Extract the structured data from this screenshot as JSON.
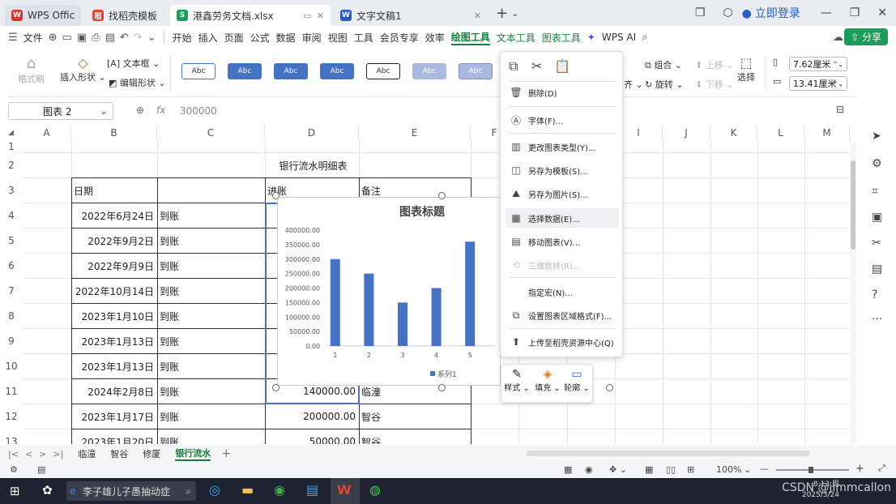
{
  "tabs": [
    {
      "label": "WPS Office",
      "icon_color": "#d6372c"
    },
    {
      "label": "找稻壳模板",
      "icon_color": "#e0422e"
    },
    {
      "label": "港鑫劳务文档.xlsx",
      "icon_color": "#1a9d56"
    },
    {
      "label": "文字文稿1",
      "icon_color": "#2b5cc5"
    }
  ],
  "login_label": "立即登录",
  "menu": {
    "file": "文件",
    "items": [
      "开始",
      "插入",
      "页面",
      "公式",
      "数据",
      "审阅",
      "视图",
      "工具",
      "会员专享",
      "效率"
    ],
    "draw_tool": "绘图工具",
    "text_tool": "文本工具",
    "chart_tool": "图表工具",
    "ai": "WPS AI",
    "share": "分享"
  },
  "ribbon": {
    "format_painter": "格式刷",
    "insert_shape": "插入形状",
    "textbox": "文本框",
    "edit_shape": "编辑形状",
    "style_label": "Abc",
    "group": "组合",
    "rotate": "旋转",
    "move_up": "上移",
    "move_down": "下移",
    "align_short": "齐",
    "select": "选择",
    "width": "7.62厘米",
    "height": "13.41厘米"
  },
  "formula_bar": {
    "name": "图表 2",
    "fx": "fx",
    "value": "300000"
  },
  "columns": [
    "A",
    "B",
    "C",
    "D",
    "E",
    "F",
    "G",
    "H",
    "I",
    "J",
    "K",
    "L",
    "M"
  ],
  "rows": [
    "1",
    "2",
    "3",
    "4",
    "5",
    "6",
    "7",
    "8",
    "9",
    "10",
    "11",
    "12",
    "13"
  ],
  "table": {
    "title": "银行流水明细表",
    "headers": [
      "日期",
      "进账",
      "备注"
    ],
    "dates": [
      "2022年6月24日",
      "2022年9月2日",
      "2022年9月9日",
      "2022年10月14日",
      "2023年1月10日",
      "2023年1月13日",
      "2023年1月13日",
      "2024年2月8日",
      "2023年1月17日",
      "2023年1月20日"
    ],
    "status": [
      "到账",
      "到账",
      "到账",
      "到账",
      "到账",
      "到账",
      "到账",
      "到账",
      "到账",
      "到账"
    ],
    "amounts_visible": [
      {
        "row": 11,
        "amount": "140000.00",
        "note": "临潼"
      },
      {
        "row": 12,
        "amount": "200000.00",
        "note": "智谷"
      },
      {
        "row": 13,
        "amount": "50000.00",
        "note": "智谷"
      }
    ]
  },
  "chart_data": {
    "type": "bar",
    "title": "图表标题",
    "categories": [
      "1",
      "2",
      "3",
      "4",
      "5"
    ],
    "series": [
      {
        "name": "系列1",
        "values": [
          300000,
          250000,
          150000,
          200000,
          360000
        ]
      }
    ],
    "y_ticks": [
      "400000.00",
      "350000.00",
      "300000.00",
      "250000.00",
      "200000.00",
      "150000.00",
      "100000.00",
      "50000.00",
      "0.00"
    ],
    "ylim": [
      0,
      400000
    ],
    "color": "#4472c4",
    "legend": "bottom"
  },
  "context_menu": {
    "delete": "删除(D)",
    "font": "字体(F)...",
    "change_type": "更改图表类型(Y)...",
    "save_template": "另存为模板(S)...",
    "save_image": "另存为图片(S)...",
    "select_data": "选择数据(E)...",
    "move_chart": "移动图表(V)...",
    "rotate_3d": "三维旋转(R)...",
    "assign_macro": "指定宏(N)...",
    "format_area": "设置图表区域格式(F)...",
    "upload": "上传至稻壳资源中心(Q)"
  },
  "mini_toolbar": {
    "style": "样式",
    "fill": "填充",
    "outline": "轮廓"
  },
  "sheets": [
    "临潼",
    "智谷",
    "修厦",
    "银行流水"
  ],
  "status": {
    "zoom": "100%"
  },
  "taskbar": {
    "search_text": "李子雄儿子愚抽动症",
    "clock_time": "8:13 周",
    "clock_date": "2025/3/24",
    "watermark": "CSDN @jimmcallon"
  }
}
